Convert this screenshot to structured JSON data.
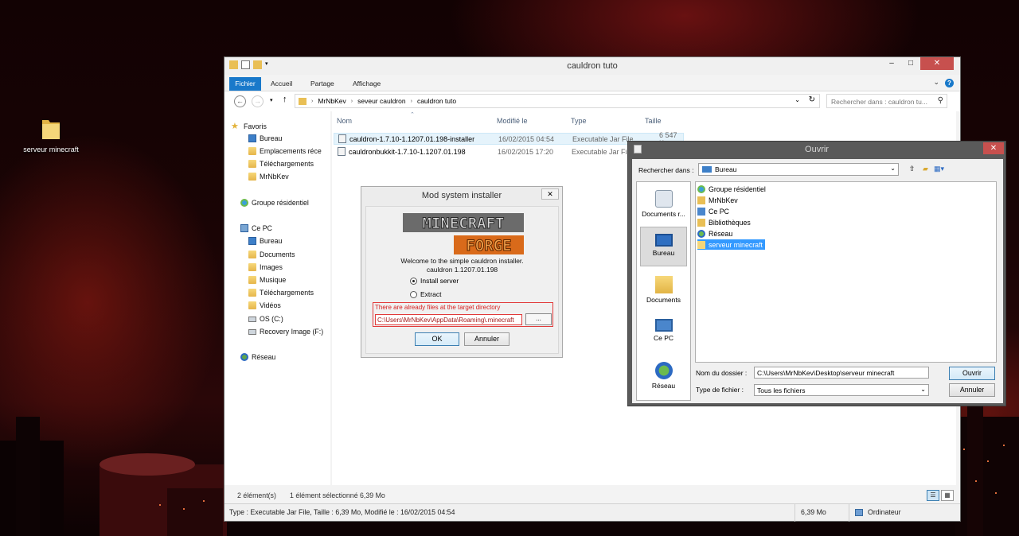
{
  "desktop": {
    "icon_label": "serveur minecraft"
  },
  "explorer": {
    "title": "cauldron tuto",
    "ribbon_tabs": [
      "Fichier",
      "Accueil",
      "Partage",
      "Affichage"
    ],
    "breadcrumb": [
      "MrNbKev",
      "seveur cauldron",
      "cauldron tuto"
    ],
    "search_placeholder": "Rechercher dans : cauldron tu...",
    "nav": {
      "favorites_label": "Favoris",
      "favorites": [
        "Bureau",
        "Emplacements réce",
        "Téléchargements",
        "MrNbKev"
      ],
      "homegroup": "Groupe résidentiel",
      "pc_label": "Ce PC",
      "pc_items": [
        "Bureau",
        "Documents",
        "Images",
        "Musique",
        "Téléchargements",
        "Vidéos",
        "OS (C:)",
        "Recovery Image (F:)"
      ],
      "network": "Réseau"
    },
    "columns": [
      "Nom",
      "Modifié le",
      "Type",
      "Taille"
    ],
    "files": [
      {
        "name": "cauldron-1.7.10-1.1207.01.198-installer",
        "modified": "16/02/2015 04:54",
        "type": "Executable Jar File",
        "size": "6 547 Ko"
      },
      {
        "name": "cauldronbukkit-1.7.10-1.1207.01.198",
        "modified": "16/02/2015 17:20",
        "type": "Executable Jar File",
        "size": ""
      }
    ],
    "status": {
      "count": "2 élément(s)",
      "selected": "1 élément sélectionné  6,39 Mo"
    },
    "details": {
      "info": "Type : Executable Jar File, Taille : 6,39 Mo, Modifié le : 16/02/2015 04:54",
      "size": "6,39 Mo",
      "location": "Ordinateur"
    }
  },
  "installer": {
    "title": "Mod system installer",
    "logo_top": "MINECRAFT",
    "logo_bottom": "FORGE",
    "welcome_line1": "Welcome to the simple cauldron installer.",
    "welcome_line2": "cauldron 1.1207.01.198",
    "option_install": "Install server",
    "option_extract": "Extract",
    "error": "There are already files at the target directory",
    "path": "C:\\Users\\MrNbKev\\AppData\\Roaming\\.minecraft",
    "browse_label": "...",
    "ok_label": "OK",
    "cancel_label": "Annuler"
  },
  "ouvrir": {
    "title": "Ouvrir",
    "lookin_label": "Rechercher dans :",
    "lookin_value": "Bureau",
    "places": [
      "Documents r...",
      "Bureau",
      "Documents",
      "Ce PC",
      "Réseau"
    ],
    "files": [
      "Groupe résidentiel",
      "MrNbKev",
      "Ce PC",
      "Bibliothèques",
      "Réseau",
      "serveur minecraft"
    ],
    "folder_label": "Nom du dossier :",
    "folder_value": "C:\\Users\\MrNbKev\\Desktop\\serveur minecraft",
    "type_label": "Type de fichier :",
    "type_value": "Tous les fichiers",
    "open_label": "Ouvrir",
    "cancel_label": "Annuler"
  }
}
